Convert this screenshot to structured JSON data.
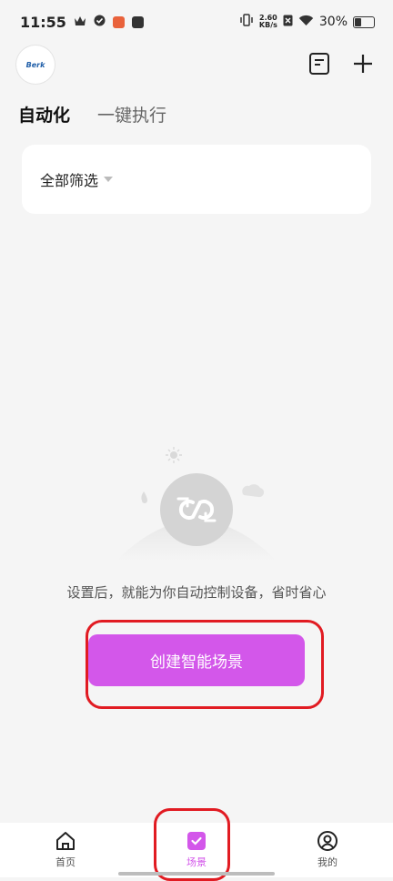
{
  "status_bar": {
    "time": "11:55",
    "speed_value": "2.60",
    "speed_unit": "KB/s",
    "battery": "30%",
    "icons": [
      "crown-icon",
      "check-badge-icon",
      "app-icon",
      "bag-icon",
      "vibrate-icon",
      "no-sim-icon",
      "wifi-icon",
      "battery-icon"
    ]
  },
  "header": {
    "logo_text": "Berk",
    "icons": [
      "list-doc-icon",
      "plus-icon"
    ]
  },
  "tabs": [
    {
      "label": "自动化",
      "active": true
    },
    {
      "label": "一键执行",
      "active": false
    }
  ],
  "filter": {
    "label": "全部筛选",
    "icon": "caret-down-icon"
  },
  "empty_state": {
    "illustration_icon": "loop-icon",
    "text": "设置后，就能为你自动控制设备，省时省心"
  },
  "create_button": {
    "label": "创建智能场景"
  },
  "bottom_nav": [
    {
      "label": "首页",
      "icon": "home-icon",
      "active": false
    },
    {
      "label": "场景",
      "icon": "scene-check-icon",
      "active": true
    },
    {
      "label": "我的",
      "icon": "user-icon",
      "active": false
    }
  ],
  "colors": {
    "accent": "#d357ea",
    "highlight": "#e11b22",
    "background": "#f5f5f5"
  }
}
